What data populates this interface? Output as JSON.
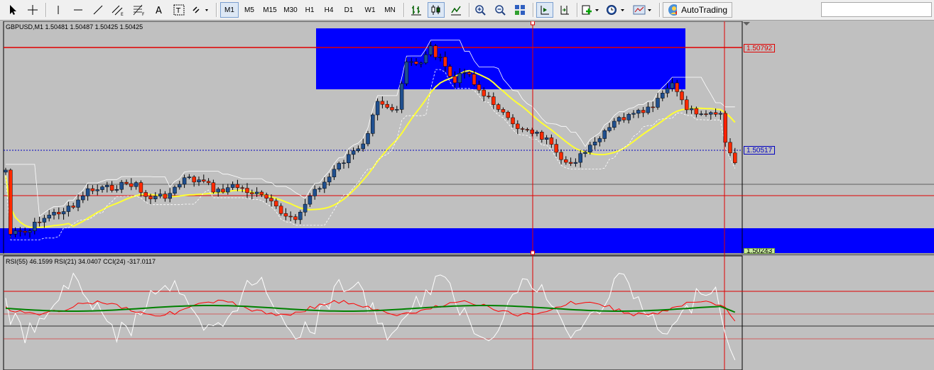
{
  "toolbar": {
    "timeframes": [
      "M1",
      "M5",
      "M15",
      "M30",
      "H1",
      "H4",
      "D1",
      "W1",
      "MN"
    ],
    "autotrading_label": "AutoTrading",
    "search_value": ""
  },
  "chart": {
    "symbol_info": "GBPUSD,M1  1.50481 1.50487 1.50425 1.50425",
    "indicator_info": "RSI(55) 46.1599  RSI(21) 34.0407  CCI(24) -317.0117",
    "price_tags": [
      "1.50792",
      "1.50517",
      "1.50243"
    ]
  },
  "colors": {
    "background": "#c0c0c0",
    "bull_candle": "#1f4f8f",
    "bear_candle": "#ff2a00",
    "zone": "#0000ff",
    "ma": "#ffff33",
    "rsi55": "#008000",
    "rsi21": "#ff0000",
    "cci": "#ffffff"
  }
}
